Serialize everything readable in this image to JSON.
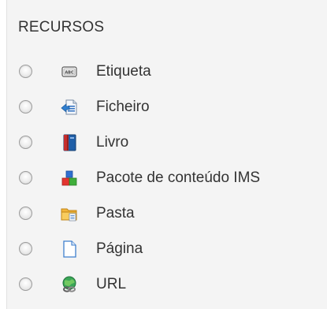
{
  "section": {
    "title": "RECURSOS"
  },
  "resources": [
    {
      "label": "Etiqueta",
      "icon": "label-icon"
    },
    {
      "label": "Ficheiro",
      "icon": "file-icon"
    },
    {
      "label": "Livro",
      "icon": "book-icon"
    },
    {
      "label": "Pacote de conteúdo IMS",
      "icon": "ims-package-icon"
    },
    {
      "label": "Pasta",
      "icon": "folder-icon"
    },
    {
      "label": "Página",
      "icon": "page-icon"
    },
    {
      "label": "URL",
      "icon": "url-icon"
    }
  ],
  "colors": {
    "panel_background": "#f4f4f4",
    "text": "#333333",
    "radio_border": "#9d9d9d"
  }
}
